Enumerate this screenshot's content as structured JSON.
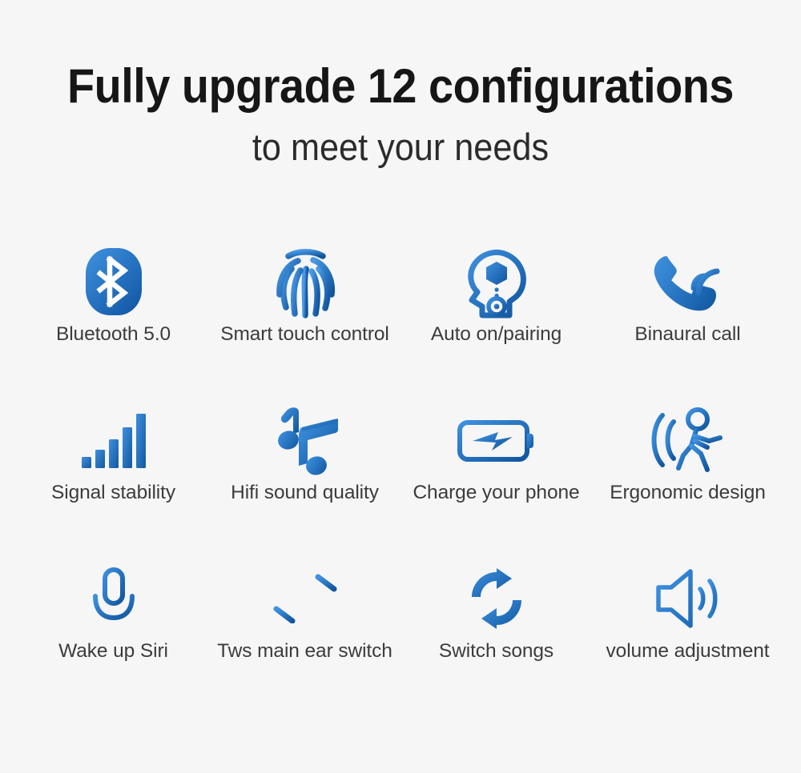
{
  "background_color": "#f6f6f6",
  "accent_blue_light": "#3a8ddd",
  "accent_blue_dark": "#11579f",
  "header": {
    "title": "Fully upgrade 12 configurations",
    "subtitle": "to meet your needs"
  },
  "features": [
    {
      "icon": "bluetooth-icon",
      "label": "Bluetooth 5.0"
    },
    {
      "icon": "fingerprint-icon",
      "label": "Smart touch control"
    },
    {
      "icon": "head-auto-pairing-icon",
      "label": "Auto on/pairing"
    },
    {
      "icon": "phone-call-waves-icon",
      "label": "Binaural call"
    },
    {
      "icon": "signal-bars-icon",
      "label": "Signal stability"
    },
    {
      "icon": "music-notes-icon",
      "label": "Hifi sound quality"
    },
    {
      "icon": "battery-charge-icon",
      "label": "Charge your phone"
    },
    {
      "icon": "walking-person-waves-icon",
      "label": "Ergonomic design"
    },
    {
      "icon": "microphone-icon",
      "label": "Wake up Siri"
    },
    {
      "icon": "two-way-arrows-icon",
      "label": "Tws main ear switch"
    },
    {
      "icon": "loop-arrows-icon",
      "label": "Switch songs"
    },
    {
      "icon": "speaker-volume-icon",
      "label": "volume adjustment"
    }
  ]
}
